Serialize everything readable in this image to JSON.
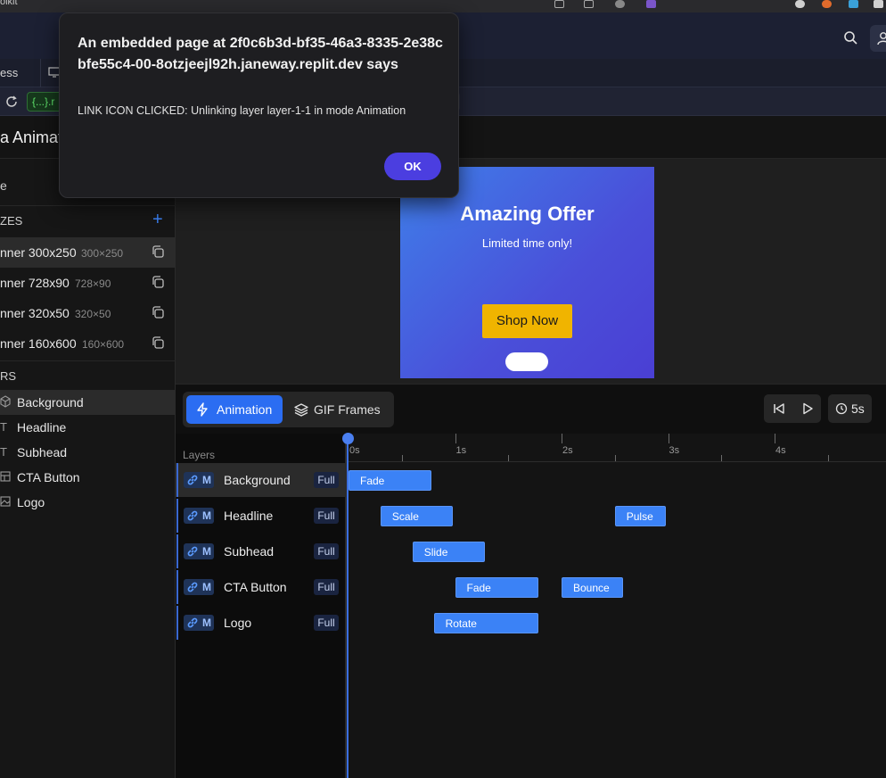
{
  "os_bar": {
    "title_fragment": "olkit"
  },
  "tabs": {
    "tab_fragment": "ess"
  },
  "url_bar": {
    "badge": "{...}.r"
  },
  "page": {
    "title_fragment": "a Animat"
  },
  "sidebar": {
    "top_fragment": "e",
    "sizes_header": "ZES",
    "sizes": [
      {
        "name": "nner 300x250",
        "dims": "300×250"
      },
      {
        "name": "nner 728x90",
        "dims": "728×90"
      },
      {
        "name": "nner 320x50",
        "dims": "320×50"
      },
      {
        "name": "nner 160x600",
        "dims": "160×600"
      }
    ],
    "layers_header": "RS",
    "layers": [
      {
        "name": "Background",
        "icon": "cube-icon"
      },
      {
        "name": "Headline",
        "icon": "text-icon"
      },
      {
        "name": "Subhead",
        "icon": "text-icon"
      },
      {
        "name": "CTA Button",
        "icon": "layout-icon"
      },
      {
        "name": "Logo",
        "icon": "image-icon"
      }
    ]
  },
  "banner": {
    "title": "Amazing Offer",
    "subtitle": "Limited time only!",
    "cta": "Shop Now"
  },
  "timeline_toolbar": {
    "animation_label": "Animation",
    "gif_label": "GIF Frames",
    "duration": "5s"
  },
  "timeline": {
    "layers_header": "Layers",
    "ticks": [
      "0s",
      "1s",
      "2s",
      "3s",
      "4s"
    ],
    "mode_letter": "M",
    "rows": [
      {
        "name": "Background",
        "range": "Full",
        "clips": [
          {
            "label": "Fade",
            "start": 0.0,
            "end": 0.78
          }
        ]
      },
      {
        "name": "Headline",
        "range": "Full",
        "clips": [
          {
            "label": "Scale",
            "start": 0.3,
            "end": 0.98
          },
          {
            "label": "Pulse",
            "start": 2.5,
            "end": 2.98
          }
        ]
      },
      {
        "name": "Subhead",
        "range": "Full",
        "clips": [
          {
            "label": "Slide",
            "start": 0.6,
            "end": 1.28
          }
        ]
      },
      {
        "name": "CTA Button",
        "range": "Full",
        "clips": [
          {
            "label": "Fade",
            "start": 1.0,
            "end": 1.78
          },
          {
            "label": "Bounce",
            "start": 2.0,
            "end": 2.58
          }
        ]
      },
      {
        "name": "Logo",
        "range": "Full",
        "clips": [
          {
            "label": "Rotate",
            "start": 0.8,
            "end": 1.78
          }
        ]
      }
    ]
  },
  "dialog": {
    "title": "An embedded page at 2f0c6b3d-bf35-46a3-8335-2e38cbfe55c4-00-8otzjeejl92h.janeway.replit.dev says",
    "message": "LINK ICON CLICKED: Unlinking layer layer-1-1 in mode Animation",
    "ok_label": "OK"
  },
  "colors": {
    "accent": "#2b6df2",
    "clip": "#3b82f6",
    "cta": "#f0b400",
    "dialog_button": "#4b3ee0"
  }
}
